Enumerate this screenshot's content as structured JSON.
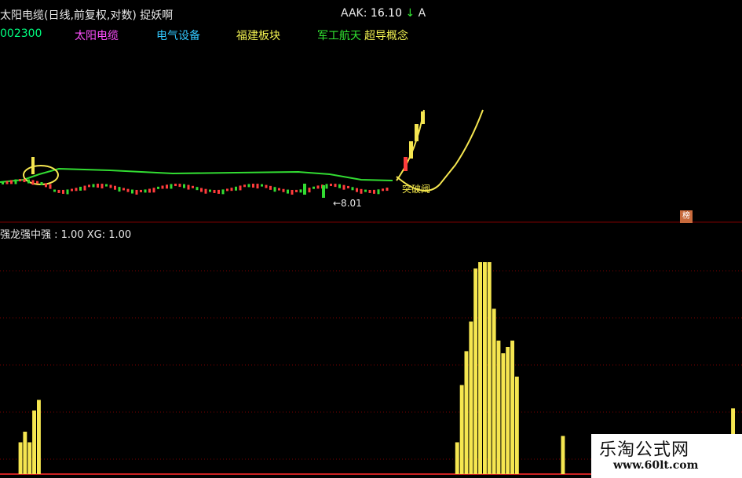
{
  "header": {
    "title": "太阳电缆(日线,前复权,对数) 捉妖啊",
    "aak_label": "AAK:",
    "aak_value": "16.10",
    "aak_arrow": "↓",
    "aak_tail": "A",
    "stock_code": "002300",
    "tags": [
      {
        "label": "太阳电缆",
        "color": "#ff50ff"
      },
      {
        "label": "电气设备",
        "color": "#32c8ff"
      },
      {
        "label": "福建板块",
        "color": "#f0f050"
      },
      {
        "label": "军工航天",
        "color": "#32e632"
      },
      {
        "label": "超导概念",
        "color": "#f0f050"
      }
    ]
  },
  "price_panel": {
    "low_annotation": "←8.01",
    "breakout_annotation": "突破阈",
    "flag_text": "榜"
  },
  "indicator_panel": {
    "label": "强龙强中强 : 1.00 XG: 1.00"
  },
  "colors": {
    "background": "#000000",
    "ma_line": "#32dc32",
    "up_candle": "#ff3c3c",
    "down_candle": "#32dc32",
    "yellow": "#f5e650",
    "grid_red": "#7a0000"
  },
  "chart_data": {
    "type": "bar",
    "title": "强龙强中强",
    "values": [
      0,
      0,
      0,
      0.15,
      0.2,
      0.15,
      0.3,
      0.35,
      0,
      0,
      0,
      0,
      0,
      0,
      0,
      0,
      0,
      0,
      0,
      0,
      0,
      0,
      0,
      0,
      0,
      0,
      0,
      0,
      0,
      0,
      0,
      0,
      0,
      0,
      0,
      0,
      0,
      0,
      0,
      0,
      0,
      0,
      0,
      0,
      0,
      0,
      0,
      0,
      0,
      0,
      0,
      0,
      0,
      0,
      0,
      0,
      0,
      0,
      0,
      0,
      0,
      0,
      0,
      0,
      0,
      0,
      0,
      0,
      0,
      0,
      0,
      0,
      0,
      0,
      0,
      0,
      0,
      0,
      0,
      0,
      0,
      0,
      0,
      0,
      0,
      0,
      0,
      0,
      0,
      0,
      0,
      0,
      0,
      0,
      0,
      0,
      0,
      0,
      0.15,
      0.42,
      0.58,
      0.72,
      0.97,
      1.0,
      1.0,
      1.0,
      0.78,
      0.63,
      0.57,
      0.6,
      0.63,
      0.46,
      0,
      0,
      0,
      0,
      0,
      0,
      0,
      0,
      0,
      0.18,
      0,
      0,
      0,
      0,
      0,
      0,
      0,
      0,
      0,
      0,
      0,
      0,
      0,
      0,
      0,
      0,
      0,
      0,
      0,
      0,
      0,
      0,
      0,
      0,
      0,
      0,
      0,
      0,
      0,
      0,
      0,
      0,
      0,
      0,
      0,
      0.02,
      0.31
    ]
  }
}
